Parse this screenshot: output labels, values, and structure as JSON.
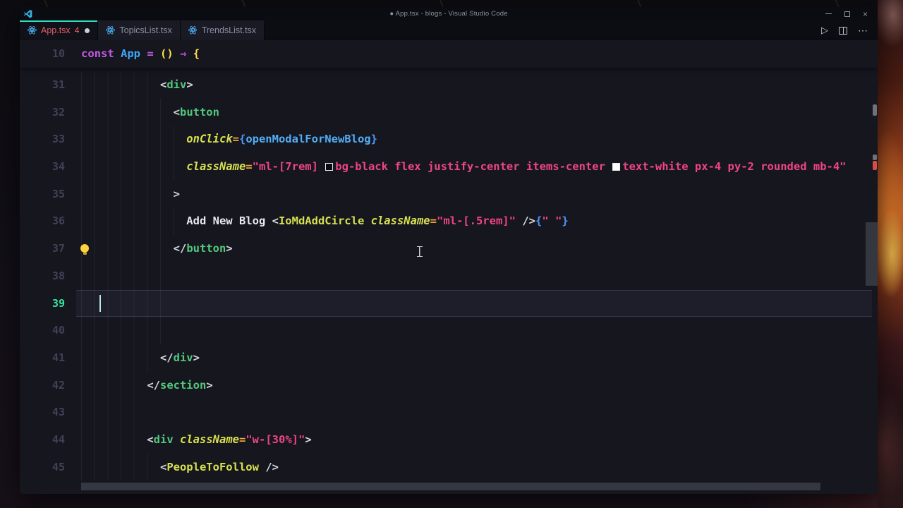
{
  "window": {
    "title": "● App.tsx - blogs - Visual Studio Code",
    "controls": {
      "minimize": "minimize",
      "maximize": "maximize",
      "close_glyph": "×"
    }
  },
  "tabs": [
    {
      "label": "App.tsx",
      "error_count": "4",
      "modified": true,
      "active": true,
      "icon": "react-icon"
    },
    {
      "label": "TopicsList.tsx",
      "active": false,
      "icon": "react-icon"
    },
    {
      "label": "TrendsList.tsx",
      "active": false,
      "icon": "react-icon"
    }
  ],
  "editor_actions": {
    "run_glyph": "▷",
    "more_glyph": "⋯"
  },
  "colors": {
    "accent_tab_border": "#2ee0bd",
    "error_red": "#e25d6a",
    "editor_bg": "#15161e",
    "keyword": "#c65ae8",
    "tag_green": "#52c97d",
    "attr_yellow": "#d8e04f",
    "string_pink": "#ee4584",
    "jsx_brace_blue": "#4f93f5",
    "paren_yellow": "#ffdf4f",
    "current_line_number": "#35e5a2",
    "lightbulb": "#ffd23e"
  },
  "editor": {
    "cursor": {
      "line": "39"
    },
    "lightbulb_line": "37",
    "sticky": {
      "n": "10",
      "indent": 0,
      "seg": [
        [
          "kw",
          "const"
        ],
        [
          "plain",
          " "
        ],
        [
          "fn",
          "App"
        ],
        [
          "plain",
          " "
        ],
        [
          "opp",
          "="
        ],
        [
          "plain",
          " "
        ],
        [
          "yel",
          "()"
        ],
        [
          "plain",
          " "
        ],
        [
          "opp",
          "⇒"
        ],
        [
          "plain",
          " "
        ],
        [
          "yel",
          "{"
        ]
      ]
    },
    "lines": [
      {
        "n": "31",
        "indent": 12,
        "seg": [
          [
            "br",
            "<"
          ],
          [
            "tag",
            "div"
          ],
          [
            "br",
            ">"
          ]
        ]
      },
      {
        "n": "32",
        "indent": 14,
        "seg": [
          [
            "br",
            "<"
          ],
          [
            "tag",
            "button"
          ]
        ]
      },
      {
        "n": "33",
        "indent": 16,
        "seg": [
          [
            "attr",
            "onClick"
          ],
          [
            "eq",
            "="
          ],
          [
            "jxb",
            "{"
          ],
          [
            "id",
            "openModalForNewBlog"
          ],
          [
            "jxb",
            "}"
          ]
        ]
      },
      {
        "n": "34",
        "indent": 16,
        "seg": [
          [
            "attr",
            "className"
          ],
          [
            "eq",
            "="
          ],
          [
            "str",
            "\"ml-[7rem] "
          ],
          [
            "swd",
            ""
          ],
          [
            "str",
            "bg-black flex justify-center items-center "
          ],
          [
            "swl",
            ""
          ],
          [
            "str",
            "text-white px-4 py-2 rounded mb-4\""
          ]
        ]
      },
      {
        "n": "35",
        "indent": 14,
        "seg": [
          [
            "br",
            ">"
          ]
        ]
      },
      {
        "n": "36",
        "indent": 16,
        "seg": [
          [
            "plain",
            "Add New Blog "
          ],
          [
            "br",
            "<"
          ],
          [
            "comp",
            "IoMdAddCircle"
          ],
          [
            "plain",
            " "
          ],
          [
            "attr",
            "className"
          ],
          [
            "eq",
            "="
          ],
          [
            "str",
            "\"ml-[.5rem]\""
          ],
          [
            "plain",
            " "
          ],
          [
            "br",
            "/>"
          ],
          [
            "jxb",
            "{"
          ],
          [
            "str",
            "\" \""
          ],
          [
            "jxb",
            "}"
          ]
        ]
      },
      {
        "n": "37",
        "indent": 14,
        "seg": [
          [
            "br",
            "</"
          ],
          [
            "tag",
            "button"
          ],
          [
            "br",
            ">"
          ]
        ]
      },
      {
        "n": "38",
        "indent": 14,
        "seg": []
      },
      {
        "n": "39",
        "indent": 14,
        "seg": [],
        "current": true
      },
      {
        "n": "40",
        "indent": 14,
        "seg": []
      },
      {
        "n": "41",
        "indent": 12,
        "seg": [
          [
            "br",
            "</"
          ],
          [
            "tag",
            "div"
          ],
          [
            "br",
            ">"
          ]
        ]
      },
      {
        "n": "42",
        "indent": 10,
        "seg": [
          [
            "br",
            "</"
          ],
          [
            "tag",
            "section"
          ],
          [
            "br",
            ">"
          ]
        ]
      },
      {
        "n": "43",
        "indent": 10,
        "seg": []
      },
      {
        "n": "44",
        "indent": 10,
        "seg": [
          [
            "br",
            "<"
          ],
          [
            "tag",
            "div"
          ],
          [
            "plain",
            " "
          ],
          [
            "attr",
            "className"
          ],
          [
            "eq",
            "="
          ],
          [
            "str",
            "\"w-[30%]\""
          ],
          [
            "br",
            ">"
          ]
        ]
      },
      {
        "n": "45",
        "indent": 12,
        "seg": [
          [
            "br",
            "<"
          ],
          [
            "comp",
            "PeopleToFollow"
          ],
          [
            "plain",
            " "
          ],
          [
            "br",
            "/>"
          ]
        ]
      }
    ]
  }
}
